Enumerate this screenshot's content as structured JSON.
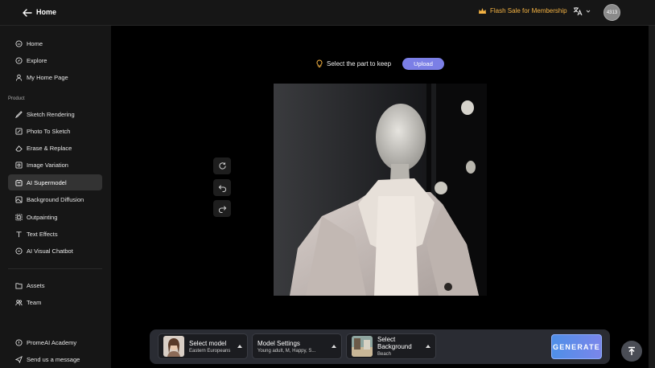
{
  "header": {
    "title": "Home",
    "promo": "Flash Sale for Membership",
    "avatar_text": "4313"
  },
  "sidebar": {
    "top_items": [
      {
        "label": "Home",
        "icon": "home-icon"
      },
      {
        "label": "Explore",
        "icon": "compass-icon"
      },
      {
        "label": "My Home Page",
        "icon": "user-icon"
      }
    ],
    "section_label": "Product",
    "product_items": [
      {
        "label": "Sketch Rendering",
        "icon": "sketch-icon"
      },
      {
        "label": "Photo To Sketch",
        "icon": "photo-sketch-icon"
      },
      {
        "label": "Erase & Replace",
        "icon": "erase-icon"
      },
      {
        "label": "Image Variation",
        "icon": "variation-icon"
      },
      {
        "label": "AI Supermodel",
        "icon": "supermodel-icon",
        "active": true
      },
      {
        "label": "Background Diffusion",
        "icon": "diffusion-icon"
      },
      {
        "label": "Outpainting",
        "icon": "outpaint-icon"
      },
      {
        "label": "Text Effects",
        "icon": "text-icon"
      },
      {
        "label": "AI Visual Chatbot",
        "icon": "chatbot-icon"
      }
    ],
    "asset_items": [
      {
        "label": "Assets",
        "icon": "folder-icon"
      },
      {
        "label": "Team",
        "icon": "team-icon"
      }
    ],
    "bottom_items": [
      {
        "label": "PromeAI Academy",
        "icon": "academy-icon"
      },
      {
        "label": "Send us a message",
        "icon": "send-icon"
      }
    ]
  },
  "canvas": {
    "hint": "Select the part to keep",
    "upload_label": "Upload"
  },
  "controls": {
    "model": {
      "title": "Select model",
      "value": "Eastern Europeans"
    },
    "settings": {
      "title": "Model Settings",
      "value": "Young adult, M, Happy, S..."
    },
    "background": {
      "title": "Select Background",
      "value": "Beach"
    },
    "generate_label": "GENERATE"
  },
  "colors": {
    "accent": "#7b7fe6",
    "promo": "#f5b343",
    "active_nav": "#333333"
  }
}
